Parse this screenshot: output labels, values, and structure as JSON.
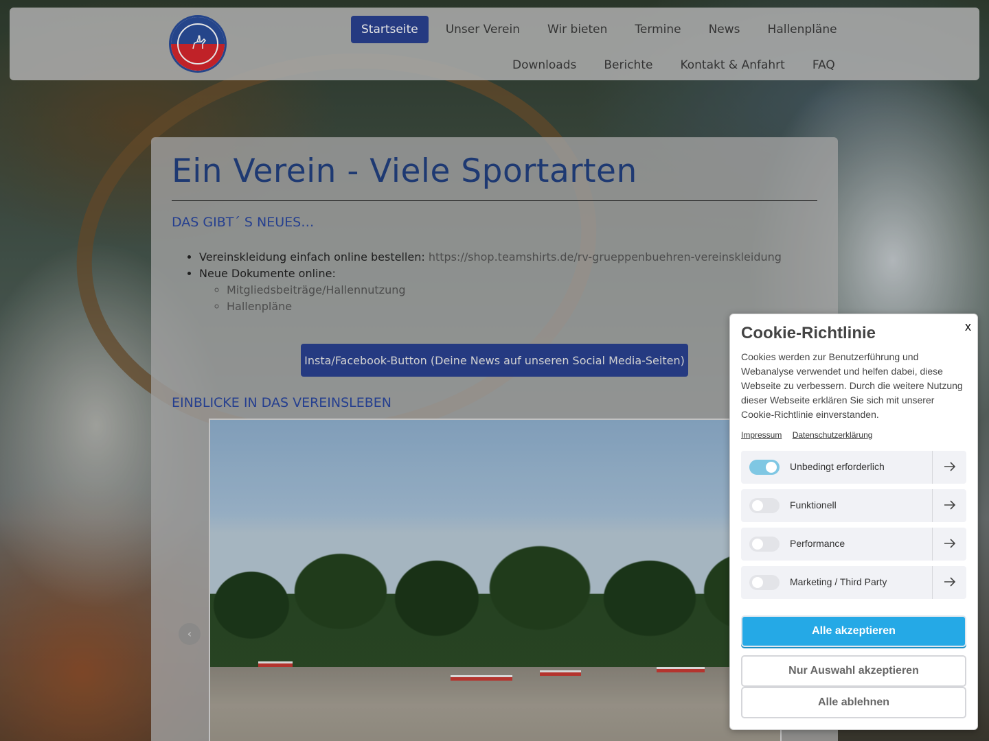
{
  "nav": {
    "row1": [
      {
        "label": "Startseite",
        "active": true
      },
      {
        "label": "Unser Verein"
      },
      {
        "label": "Wir bieten"
      },
      {
        "label": "Termine"
      },
      {
        "label": "News"
      },
      {
        "label": "Hallenpläne"
      }
    ],
    "row2": [
      {
        "label": "Downloads"
      },
      {
        "label": "Berichte"
      },
      {
        "label": "Kontakt & Anfahrt"
      },
      {
        "label": "FAQ"
      }
    ]
  },
  "main": {
    "title": "Ein Verein - Viele Sportarten",
    "news_heading": "DAS GIBT´ S NEUES…",
    "news": {
      "item1_text": "Vereinskleidung einfach online bestellen: ",
      "item1_link": "https://shop.teamshirts.de/rv-gruеppenbuehren-vereinskleidung",
      "item2_text": "Neue Dokumente online:",
      "sub_items": [
        "Mitgliedsbeiträge/Hallennutzung",
        "Hallenpläne"
      ]
    },
    "social_button": "Insta/Facebook-Button (Deine News auf unseren Social Media-Seiten)",
    "gallery_heading": "EINBLICKE IN DAS VEREINSLEBEN",
    "gallery_prev": "‹"
  },
  "cookie": {
    "title": "Cookie-Richtlinie",
    "close": "x",
    "description": "Cookies werden zur Benutzerführung und Webanalyse verwendet und helfen dabei, diese Webseite zu verbessern. Durch die weitere Nutzung dieser Webseite erklären Sie sich mit unserer Cookie-Richtlinie einverstanden.",
    "links": [
      "Impressum",
      "Datenschutzerklärung"
    ],
    "categories": [
      {
        "label": "Unbedingt erforderlich",
        "enabled": true
      },
      {
        "label": "Funktionell",
        "enabled": false
      },
      {
        "label": "Performance",
        "enabled": false
      },
      {
        "label": "Marketing / Third Party",
        "enabled": false
      }
    ],
    "accept_all": "Alle akzeptieren",
    "accept_selection": "Nur Auswahl akzeptieren",
    "reject_all": "Alle ablehnen",
    "accent_color": "#25a9e6"
  },
  "colors": {
    "nav_active": "#2a4190",
    "heading": "#22407f"
  }
}
